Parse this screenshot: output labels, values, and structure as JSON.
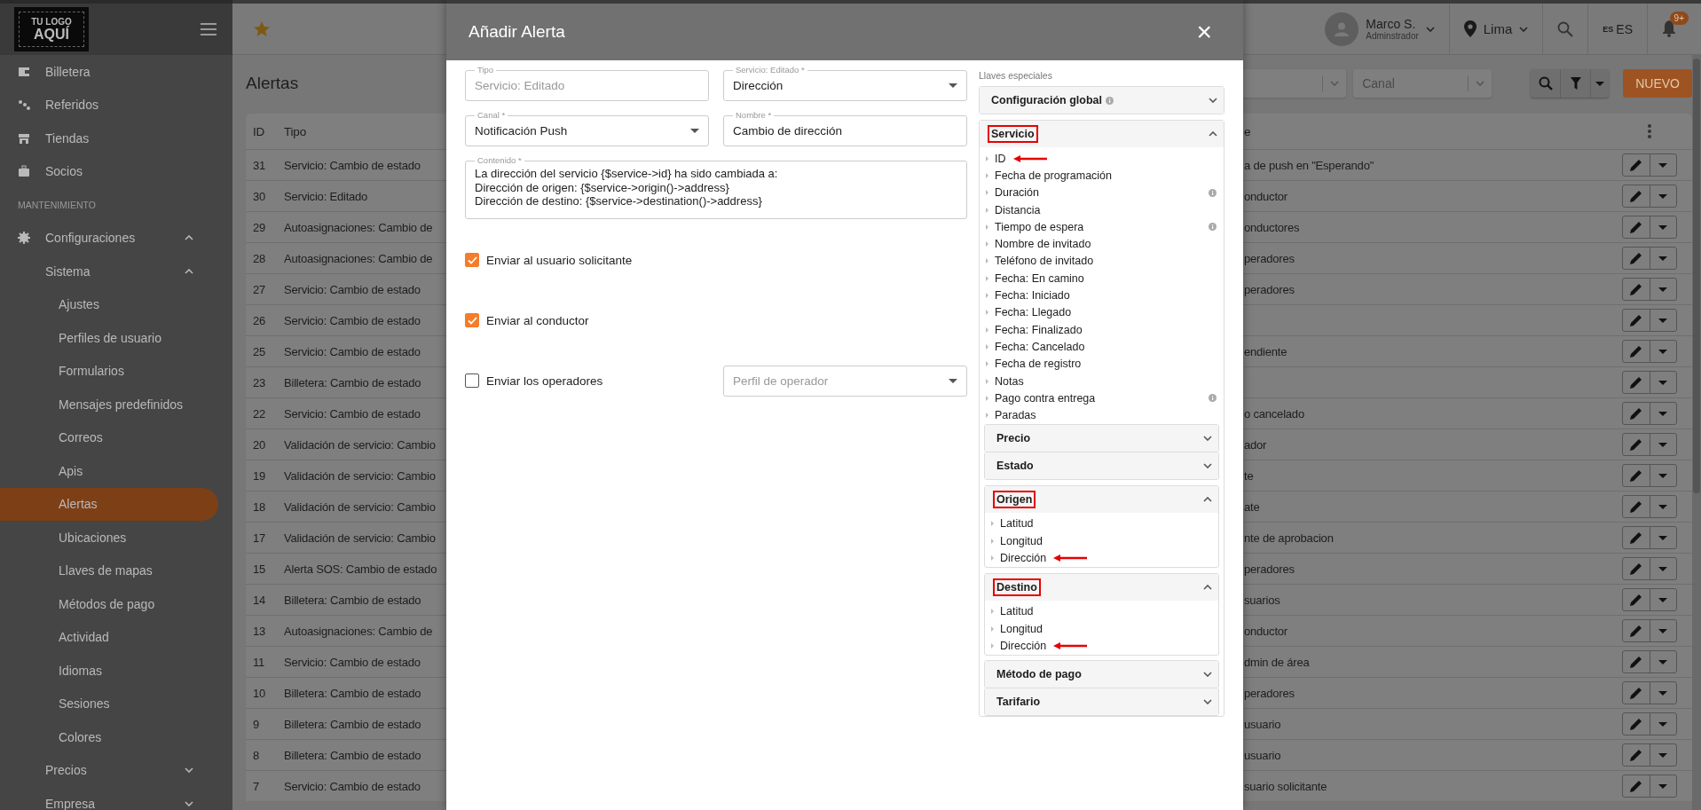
{
  "topbar": {
    "logo_lines": [
      "TU LOGO",
      "AQUÍ"
    ],
    "user": {
      "name": "Marco S.",
      "role": "Adminstrador"
    },
    "location": "Lima",
    "language": {
      "flag": "ES",
      "code": "ES"
    },
    "notifications": "9+"
  },
  "sidebar": {
    "items": [
      {
        "kind": "link",
        "label": "Billetera",
        "selected": false
      },
      {
        "kind": "link",
        "label": "Referidos",
        "selected": false
      },
      {
        "kind": "link",
        "label": "Tiendas",
        "selected": false
      },
      {
        "kind": "link",
        "label": "Socios",
        "selected": false
      },
      {
        "kind": "section",
        "label": "MANTENIMIENTO"
      },
      {
        "kind": "group",
        "label": "Configuraciones",
        "expanded": true,
        "children": [
          {
            "kind": "group",
            "label": "Sistema",
            "expanded": true,
            "children": [
              {
                "kind": "link",
                "label": "Ajustes",
                "selected": false
              },
              {
                "kind": "link",
                "label": "Perfiles de usuario",
                "selected": false
              },
              {
                "kind": "link",
                "label": "Formularios",
                "selected": false
              },
              {
                "kind": "link",
                "label": "Mensajes predefinidos",
                "selected": false
              },
              {
                "kind": "link",
                "label": "Correos",
                "selected": false
              },
              {
                "kind": "link",
                "label": "Apis",
                "selected": false
              },
              {
                "kind": "link",
                "label": "Alertas",
                "selected": true
              },
              {
                "kind": "link",
                "label": "Ubicaciones",
                "selected": false
              },
              {
                "kind": "link",
                "label": "Llaves de mapas",
                "selected": false
              },
              {
                "kind": "link",
                "label": "Métodos de pago",
                "selected": false
              },
              {
                "kind": "link",
                "label": "Actividad",
                "selected": false
              },
              {
                "kind": "link",
                "label": "Idiomas",
                "selected": false
              },
              {
                "kind": "link",
                "label": "Sesiones",
                "selected": false
              },
              {
                "kind": "link",
                "label": "Colores",
                "selected": false
              }
            ]
          },
          {
            "kind": "group",
            "label": "Precios",
            "expanded": false
          },
          {
            "kind": "group",
            "label": "Empresa",
            "expanded": false
          }
        ]
      }
    ]
  },
  "page": {
    "title": "Alertas",
    "filters": [
      {
        "placeholder": "Canal"
      }
    ],
    "new_button": "NUEVO"
  },
  "table": {
    "columns": [
      "ID",
      "Tipo",
      "e"
    ],
    "rows": [
      {
        "id": "31",
        "type": "Servicio: Cambio de estado",
        "column_3": "a de push en \"Esperando\""
      },
      {
        "id": "30",
        "type": "Servicio: Editado",
        "column_3": "onductor"
      },
      {
        "id": "29",
        "type": "Autoasignaciones: Cambio de",
        "column_3": "onductores"
      },
      {
        "id": "28",
        "type": "Autoasignaciones: Cambio de",
        "column_3": "peradores"
      },
      {
        "id": "27",
        "type": "Servicio: Cambio de estado",
        "column_3": "peradores"
      },
      {
        "id": "26",
        "type": "Servicio: Cambio de estado"
      },
      {
        "id": "25",
        "type": "Servicio: Cambio de estado",
        "column_3": "endiente"
      },
      {
        "id": "23",
        "type": "Billetera: Cambio de estado"
      },
      {
        "id": "22",
        "type": "Servicio: Cambio de estado",
        "column_3": "o cancelado"
      },
      {
        "id": "20",
        "type": "Validación de servicio: Cambio",
        "column_3": "ador"
      },
      {
        "id": "19",
        "type": "Validación de servicio: Cambio",
        "column_3": "te"
      },
      {
        "id": "18",
        "type": "Validación de servicio: Cambio",
        "column_3": "ate"
      },
      {
        "id": "17",
        "type": "Validación de servicio: Cambio",
        "column_3": "nte de aprobacion"
      },
      {
        "id": "15",
        "type": "Alerta SOS: Cambio de estado",
        "column_3": "peradores"
      },
      {
        "id": "14",
        "type": "Billetera: Cambio de estado",
        "column_3": "suarios"
      },
      {
        "id": "13",
        "type": "Autoasignaciones: Cambio de",
        "column_3": "onductor"
      },
      {
        "id": "11",
        "type": "Servicio: Cambio de estado",
        "column_3": "dmin de área"
      },
      {
        "id": "10",
        "type": "Billetera: Cambio de estado",
        "column_3": "peradores"
      },
      {
        "id": "9",
        "type": "Billetera: Cambio de estado",
        "column_3": "usuario"
      },
      {
        "id": "8",
        "type": "Billetera: Cambio de estado",
        "column_3": "usuario"
      },
      {
        "id": "7",
        "type": "Servicio: Cambio de estado",
        "column_3": "suario solicitante"
      }
    ]
  },
  "modal": {
    "title": "Añadir Alerta",
    "close": "×",
    "fields": [
      {
        "kind": "text",
        "label": "Tipo",
        "value": "Servicio: Editado",
        "disabled": true
      },
      {
        "kind": "select",
        "label": "Servicio: Editado *",
        "value": "Dirección",
        "disabled": false
      },
      {
        "kind": "select",
        "label": "Canal *",
        "value": "Notificación Push",
        "disabled": false
      },
      {
        "kind": "text",
        "label": "Nombre *",
        "value": "Cambio de dirección",
        "disabled": false
      }
    ],
    "content": {
      "label": "Contenido *",
      "lines": [
        "La dirección del servicio {$service->id} ha sido cambiada a:",
        "Dirección de origen: {$service->origin()->address}",
        "Dirección de destino: {$service->destination()->address}"
      ]
    },
    "options": [
      {
        "label": "Enviar al usuario solicitante",
        "checked": true
      },
      {
        "label": "Enviar al conductor",
        "checked": true
      },
      {
        "label": "Enviar los operadores",
        "checked": false,
        "select_placeholder": "Perfil de operador"
      }
    ],
    "special_keys": {
      "label": "Llaves especiales",
      "groups": [
        {
          "title": "Configuración global",
          "info": true,
          "expanded": false,
          "highlighted": false
        },
        {
          "title": "Servicio",
          "info": false,
          "expanded": true,
          "highlighted": true,
          "items": [
            {
              "label": "ID",
              "info": false,
              "arrow": true
            },
            {
              "label": "Fecha de programación",
              "info": false,
              "arrow": false
            },
            {
              "label": "Duración",
              "info": true,
              "arrow": false
            },
            {
              "label": "Distancia",
              "info": false,
              "arrow": false
            },
            {
              "label": "Tiempo de espera",
              "info": true,
              "arrow": false
            },
            {
              "label": "Nombre de invitado",
              "info": false,
              "arrow": false
            },
            {
              "label": "Teléfono de invitado",
              "info": false,
              "arrow": false
            },
            {
              "label": "Fecha: En camino",
              "info": false,
              "arrow": false
            },
            {
              "label": "Fecha: Iniciado",
              "info": false,
              "arrow": false
            },
            {
              "label": "Fecha: Llegado",
              "info": false,
              "arrow": false
            },
            {
              "label": "Fecha: Finalizado",
              "info": false,
              "arrow": false
            },
            {
              "label": "Fecha: Cancelado",
              "info": false,
              "arrow": false
            },
            {
              "label": "Fecha de registro",
              "info": false,
              "arrow": false
            },
            {
              "label": "Notas",
              "info": false,
              "arrow": false
            },
            {
              "label": "Pago contra entrega",
              "info": true,
              "arrow": false
            },
            {
              "label": "Paradas",
              "info": false,
              "arrow": false
            }
          ],
          "children": [
            {
              "title": "Precio",
              "info": false,
              "expanded": false,
              "highlighted": false
            },
            {
              "title": "Estado",
              "info": false,
              "expanded": false,
              "highlighted": false
            },
            {
              "title": "Origen",
              "info": false,
              "expanded": true,
              "highlighted": true,
              "items": [
                {
                  "label": "Latitud",
                  "info": false,
                  "arrow": false
                },
                {
                  "label": "Longitud",
                  "info": false,
                  "arrow": false
                },
                {
                  "label": "Dirección",
                  "info": false,
                  "arrow": true
                }
              ]
            },
            {
              "title": "Destino",
              "info": false,
              "expanded": true,
              "highlighted": true,
              "items": [
                {
                  "label": "Latitud",
                  "info": false,
                  "arrow": false
                },
                {
                  "label": "Longitud",
                  "info": false,
                  "arrow": false
                },
                {
                  "label": "Dirección",
                  "info": false,
                  "arrow": true
                }
              ]
            },
            {
              "title": "Método de pago",
              "info": false,
              "expanded": false,
              "highlighted": false
            },
            {
              "title": "Tarifario",
              "info": false,
              "expanded": false,
              "highlighted": false
            }
          ]
        }
      ]
    }
  }
}
